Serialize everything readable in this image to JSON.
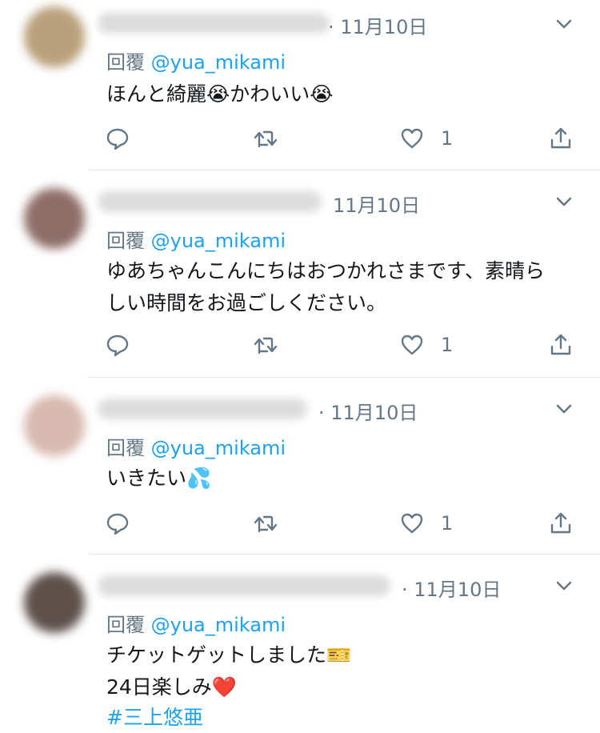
{
  "tweets": [
    {
      "date": "· 11月10日",
      "reply_prefix": "回覆 ",
      "reply_handle": "@yua_mikami",
      "text": "ほんと綺麗😭かわいい😭",
      "like_count": "1",
      "avatar_color": "#b8a07a"
    },
    {
      "date": "11月10日",
      "reply_prefix": "回覆 ",
      "reply_handle": "@yua_mikami",
      "text": "ゆあちゃんこんにちはおつかれさまです、素晴ら\nしい時間をお過ごしください。",
      "like_count": "1",
      "avatar_color": "#8f6e68"
    },
    {
      "date": "· 11月10日",
      "reply_prefix": "回覆 ",
      "reply_handle": "@yua_mikami",
      "text": "いきたい💦",
      "like_count": "1",
      "avatar_color": "#d7b9b0"
    },
    {
      "date": "· 11月10日",
      "reply_prefix": "回覆 ",
      "reply_handle": "@yua_mikami",
      "text": "チケットゲットしました🎫\n24日楽しみ❤️",
      "hashtag": "#三上悠亜",
      "avatar_color": "#5e514c"
    }
  ],
  "icons": {
    "reply": "comment-icon",
    "retweet": "retweet-icon",
    "like": "heart-icon",
    "share": "share-icon",
    "menu": "chevron-down-icon"
  },
  "colors": {
    "link": "#1da1f2",
    "secondary": "#657786",
    "divider": "#e1e8ed"
  }
}
